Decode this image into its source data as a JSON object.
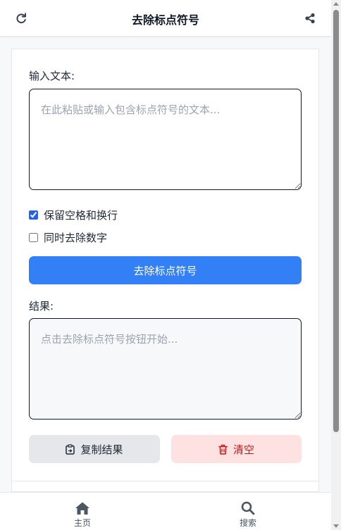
{
  "header": {
    "title": "去除标点符号",
    "refresh_icon": "refresh-icon",
    "share_icon": "share-icon"
  },
  "form": {
    "input_label": "输入文本:",
    "input_placeholder": "在此粘贴或输入包含标点符号的文本...",
    "input_value": "",
    "keep_whitespace_label": "保留空格和换行",
    "keep_whitespace_checked": true,
    "remove_digits_label": "同时去除数字",
    "remove_digits_checked": false,
    "submit_label": "去除标点符号",
    "result_label": "结果:",
    "result_placeholder": "点击去除标点符号按钮开始...",
    "result_value": "",
    "copy_label": "复制结果",
    "clear_label": "清空"
  },
  "nav": {
    "home_label": "主页",
    "search_label": "搜索"
  },
  "colors": {
    "accent": "#3380f6",
    "danger_bg": "#fee2e2",
    "danger_text": "#b91c1c",
    "secondary_bg": "#e6e7ea"
  }
}
